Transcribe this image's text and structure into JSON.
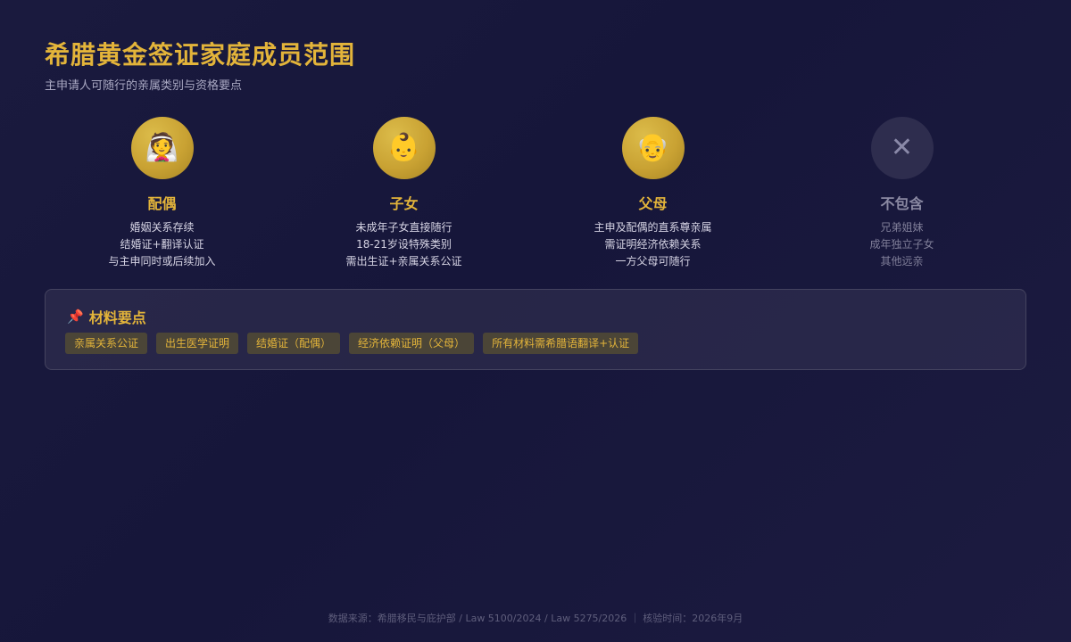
{
  "header": {
    "title": "希腊黄金签证家庭成员范围",
    "subtitle": "主申请人可随行的亲属类别与资格要点"
  },
  "members": [
    {
      "icon": "bride-with-veil-icon",
      "glyph": "👰",
      "title": "配偶",
      "lines": [
        "婚姻关系存续",
        "结婚证+翻译认证",
        "与主申同时或后续加入"
      ]
    },
    {
      "icon": "baby-icon",
      "glyph": "👶",
      "title": "子女",
      "lines": [
        "未成年子女直接随行",
        "18-21岁设特殊类别",
        "需出生证+亲属关系公证"
      ]
    },
    {
      "icon": "old-man-icon",
      "glyph": "👴",
      "title": "父母",
      "lines": [
        "主申及配偶的直系尊亲属",
        "需证明经济依赖关系",
        "一方父母可随行"
      ]
    },
    {
      "icon": "cross-mark-icon",
      "glyph": "✕",
      "title": "不包含",
      "lines": [
        "兄弟姐妹",
        "成年独立子女",
        "其他远亲"
      ]
    }
  ],
  "materials": {
    "icon": "pushpin-icon",
    "glyph": "📌",
    "title": "材料要点",
    "tags": [
      "亲属关系公证",
      "出生医学证明",
      "结婚证（配偶）",
      "经济依赖证明（父母）",
      "所有材料需希腊语翻译+认证"
    ]
  },
  "footer": {
    "text": "数据来源：希腊移民与庇护部 / Law 5100/2024 / Law 5275/2026 ｜ 核验时间：2026年9月"
  },
  "colors": {
    "accent": "#e3b43a",
    "background": "#1a1a3e",
    "muted": "#8b8aa3"
  }
}
